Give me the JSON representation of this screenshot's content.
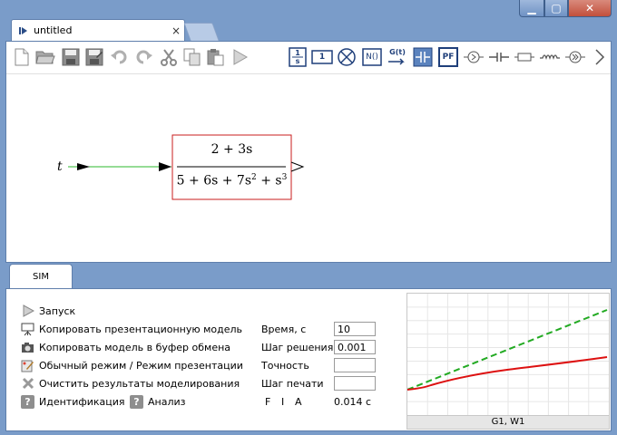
{
  "window": {
    "tab_title": "untitled",
    "tab_close": "×",
    "min_glyph": "▁",
    "max_glyph": "▢",
    "close_glyph": "✕"
  },
  "toolbar": {
    "file_icons": [
      "new-file-icon",
      "open-folder-icon",
      "save-icon",
      "save-as-icon",
      "undo-icon",
      "redo-icon",
      "cut-icon",
      "copy-icon",
      "paste-icon",
      "run-icon"
    ],
    "block_icons": [
      "integrator-block-icon",
      "constant-block-icon",
      "summator-block-icon",
      "nonlinear-block-icon",
      "transfer-function-block-icon",
      "delay-block-icon",
      "pf-block-icon",
      "source-block-icon",
      "capacitor-icon",
      "resistor-icon",
      "inductor-icon",
      "pump-icon",
      "more-chevron-icon"
    ],
    "block_labels": {
      "nonlinear": "N()",
      "transfer": "G(t)",
      "pf": "PF",
      "integrator_num": "1",
      "integrator_den": "s",
      "constant": "1"
    }
  },
  "diagram": {
    "input_label": "t",
    "tf_numerator": "2 + 3s",
    "tf_den_1": "5 + 6s + 7s",
    "tf_den_sup1": "2",
    "tf_den_2": " + s",
    "tf_den_sup2": "3",
    "colors": {
      "signal": "#2db82d",
      "block_border": "#c81e1e"
    }
  },
  "sim": {
    "tab_label": "SIM",
    "commands": {
      "run": "Запуск",
      "copy_presentation": "Копировать презентационную модель",
      "copy_clipboard": "Копировать модель в буфер обмена",
      "mode_toggle": "Обычный режим / Режим презентации",
      "clear_results": "Очистить результаты моделирования",
      "identification": "Идентификация",
      "analysis": "Анализ"
    },
    "params": {
      "time_label": "Время, с",
      "time_value": "10",
      "step_label": "Шаг решения",
      "step_value": "0.001",
      "accuracy_label": "Точность",
      "accuracy_value": "",
      "print_step_label": "Шаг печати",
      "print_step_value": ""
    },
    "flags": {
      "f": "F",
      "i": "I",
      "a": "A"
    },
    "elapsed": "0.014 с",
    "plot_caption": "G1, W1",
    "plot_series": {
      "input": {
        "color": "#22aa22",
        "dashed": true
      },
      "output": {
        "color": "#dd1111",
        "dashed": false
      }
    }
  }
}
